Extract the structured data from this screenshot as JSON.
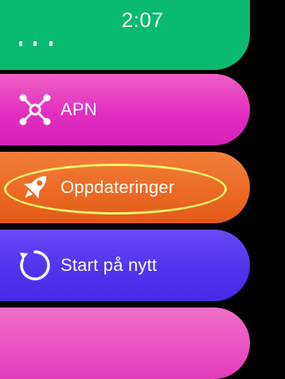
{
  "status_bar": {
    "time": "2:07"
  },
  "menu": {
    "items": [
      {
        "id": "partial-top",
        "label": "",
        "icon": "unknown-icon",
        "color": "#0aba71"
      },
      {
        "id": "apn",
        "label": "APN",
        "icon": "network-nodes-icon",
        "color": "#e12ec0"
      },
      {
        "id": "updates",
        "label": "Oppdateringer",
        "icon": "rocket-icon",
        "color": "#ec6a24",
        "highlighted": true
      },
      {
        "id": "restart",
        "label": "Start på nytt",
        "icon": "restart-icon",
        "color": "#5034ee"
      },
      {
        "id": "partial-bottom",
        "label": "",
        "icon": "",
        "color": "#e33cbd"
      }
    ]
  },
  "highlight": {
    "color": "#f3f06a"
  }
}
